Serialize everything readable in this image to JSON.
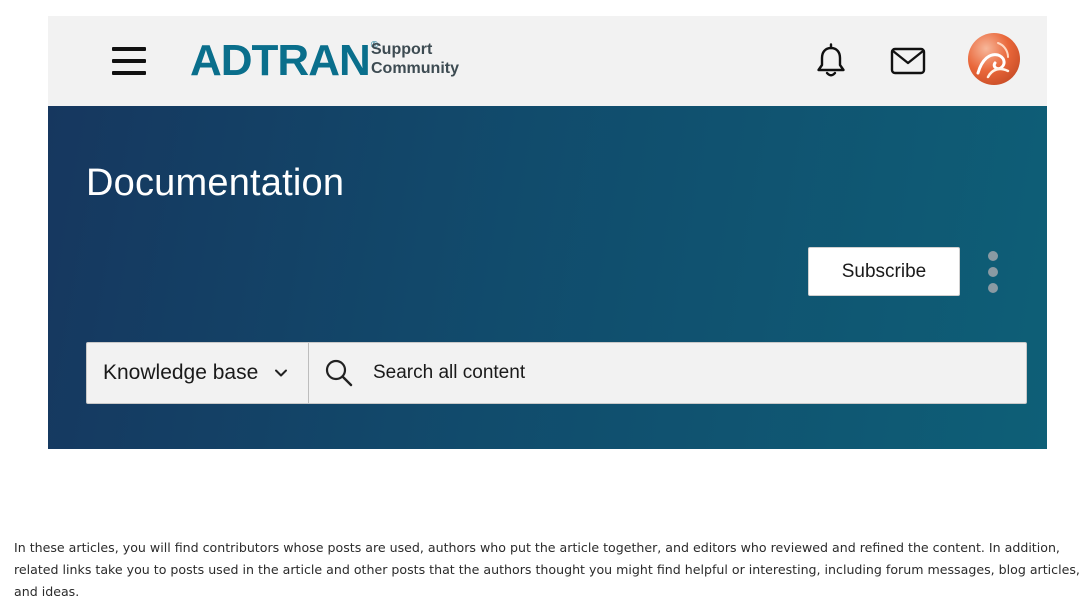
{
  "header": {
    "logo_text": "ADTRAN",
    "logo_reg": "®",
    "tagline_line1": "Support",
    "tagline_line2": "Community",
    "icons": {
      "menu": "hamburger-menu-icon",
      "notifications": "bell-icon",
      "messages": "mail-icon",
      "profile": "avatar"
    },
    "colors": {
      "brand": "#0a6f8c",
      "bar_bg": "#f2f2f2"
    }
  },
  "hero": {
    "title": "Documentation",
    "subscribe_label": "Subscribe",
    "more_options_icon": "kebab-menu-icon",
    "colors": {
      "gradient_start": "#16375f",
      "gradient_end": "#0e5f77"
    }
  },
  "search": {
    "scope_value": "Knowledge base",
    "placeholder": "Search all content"
  },
  "content": {
    "intro_paragraph": "In these articles, you will find contributors whose posts are used, authors who put the article together, and editors who reviewed and refined the content. In addition, related links take you to posts used in the article and other posts that the authors thought you might find helpful or interesting, including forum messages, blog articles, and ideas."
  }
}
